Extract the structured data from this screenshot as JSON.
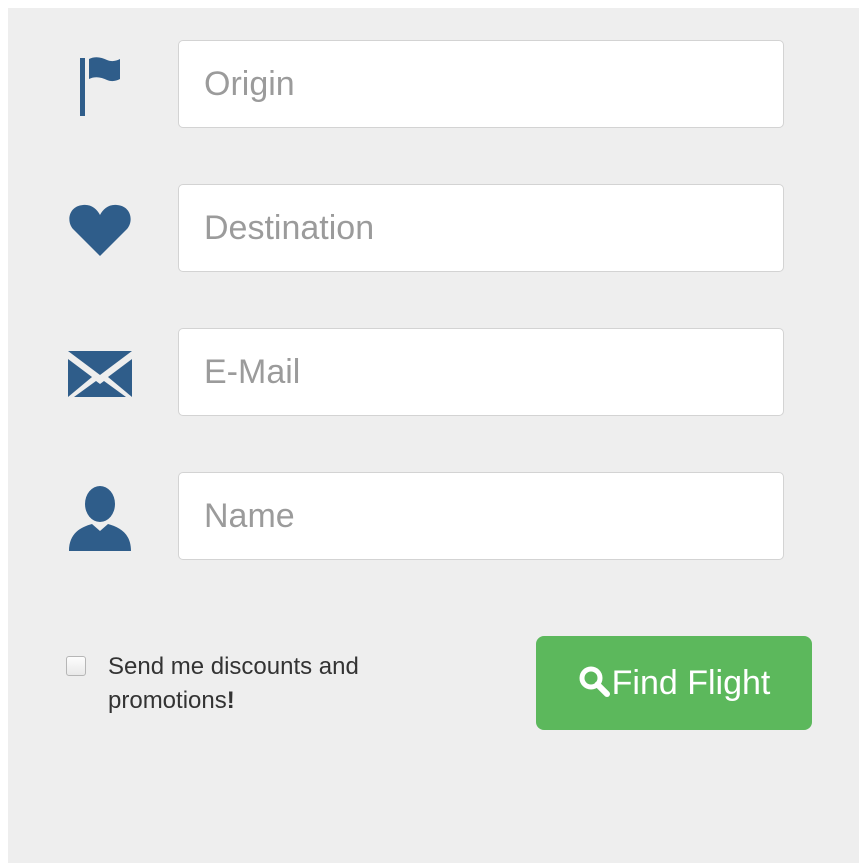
{
  "colors": {
    "icon": "#2f5d8a",
    "button": "#5cb85c",
    "panel": "#eeeeee"
  },
  "form": {
    "fields": [
      {
        "icon": "flag-icon",
        "placeholder": "Origin",
        "value": ""
      },
      {
        "icon": "heart-icon",
        "placeholder": "Destination",
        "value": ""
      },
      {
        "icon": "envelope-icon",
        "placeholder": "E-Mail",
        "value": ""
      },
      {
        "icon": "user-icon",
        "placeholder": "Name",
        "value": ""
      }
    ],
    "opt_in": {
      "label": "Send me discounts and promotions",
      "emphasis": "!",
      "checked": false
    },
    "submit": {
      "icon": "search-icon",
      "label": "Find Flight"
    }
  }
}
